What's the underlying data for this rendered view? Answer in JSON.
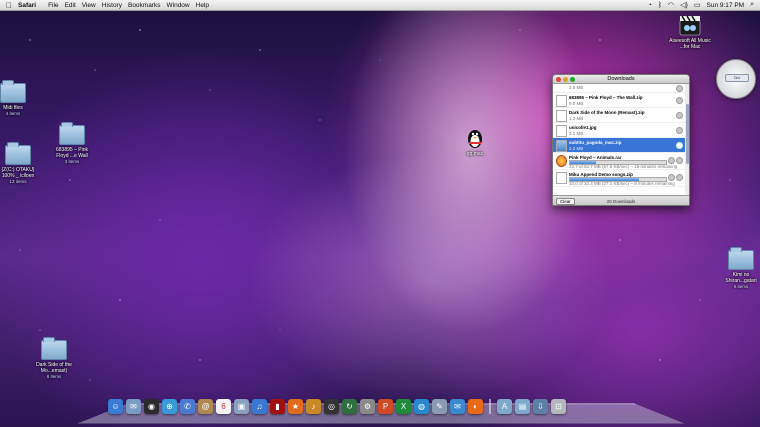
{
  "menubar": {
    "apple": "",
    "app_name": "Safari",
    "menus": [
      "File",
      "Edit",
      "View",
      "History",
      "Bookmarks",
      "Window",
      "Help"
    ],
    "clock": "Sun 9:17 PM"
  },
  "desktop": {
    "left_icons": [
      {
        "label": "Midi files",
        "sub": "4 items"
      },
      {
        "label": "683895 – Pink Floyd ...e Wall",
        "sub": "3 items"
      },
      {
        "label": "{Z(C:) OTAKU} 100% _ iclloen",
        "sub": "13 items"
      },
      {
        "label": "Dark Side of the Mo...emast)",
        "sub": "8 items"
      }
    ],
    "middle_icon": {
      "label": "qq.mac"
    },
    "right_icons": [
      {
        "label": "Aiseesoft All Music ...for Mac"
      },
      {
        "label": "Kimi no Shiran...gatari",
        "sub": "6 items"
      }
    ]
  },
  "downloads": {
    "title": "Downloads",
    "rows": [
      {
        "name": "",
        "size": "2.6 MB",
        "icon": "doc"
      },
      {
        "name": "683895 – Pink Floyd – The Wall.zip",
        "size": "9.0 MB",
        "icon": "doc"
      },
      {
        "name": "Dark Side of the Moon (Remast).zip",
        "size": "1.3 MB",
        "icon": "doc"
      },
      {
        "name": "unicolle1.jpg",
        "size": "3.1 MB",
        "icon": "doc"
      },
      {
        "name": "subtitu_pagoda_mac.zip",
        "size": "2.2 MB",
        "icon": "blue",
        "selected": true
      },
      {
        "name": "Pink Floyd – Animals.rar",
        "size": "22.7 of 82.7 MB (57.5 KB/sec) – 19 minutes remaining",
        "icon": "round",
        "progress": 0.27
      },
      {
        "name": "Miku Append Demo songs.zip",
        "size": "10.0 of 10.4 MB (27.1 KB/sec) – 8 minutes remaining",
        "icon": "doc",
        "progress": 0.72
      }
    ],
    "clear_label": "Clear",
    "count_label": "20 Downloads"
  },
  "widget": {
    "screen_text": "Dict"
  },
  "dock": {
    "icons": [
      {
        "name": "finder-icon",
        "color": "#3a7bd5",
        "glyph": "☺"
      },
      {
        "name": "preview-icon",
        "color": "#7a9bc4",
        "glyph": "✉"
      },
      {
        "name": "dashboard-icon",
        "color": "#2a2a2a",
        "glyph": "◉"
      },
      {
        "name": "safari-icon",
        "color": "#3a9ad9",
        "glyph": "⊕"
      },
      {
        "name": "ichat-icon",
        "color": "#4a7bd0",
        "glyph": "✆"
      },
      {
        "name": "address-book-icon",
        "color": "#b08950",
        "glyph": "@"
      },
      {
        "name": "ical-icon",
        "color": "#f4f4f4",
        "glyph": "6"
      },
      {
        "name": "iphoto-icon",
        "color": "#8aa0c0",
        "glyph": "▣"
      },
      {
        "name": "itunes-icon",
        "color": "#3b78d1",
        "glyph": "♫"
      },
      {
        "name": "photo-booth-icon",
        "color": "#a01010",
        "glyph": "▮"
      },
      {
        "name": "imovie-icon",
        "color": "#e06a1e",
        "glyph": "★"
      },
      {
        "name": "garageband-icon",
        "color": "#c8882a",
        "glyph": "♪"
      },
      {
        "name": "aperture-icon",
        "color": "#333333",
        "glyph": "◎"
      },
      {
        "name": "time-machine-icon",
        "color": "#2f6e3f",
        "glyph": "↻"
      },
      {
        "name": "system-preferences-icon",
        "color": "#8a8a8a",
        "glyph": "⚙"
      },
      {
        "name": "texture-app-icon",
        "color": "#d04a24",
        "glyph": "P"
      },
      {
        "name": "excel-icon",
        "color": "#1f8a3a",
        "glyph": "X"
      },
      {
        "name": "globe-icon",
        "color": "#2a88cc",
        "glyph": "◍"
      },
      {
        "name": "tool-icon",
        "color": "#8a9ab0",
        "glyph": "✎"
      },
      {
        "name": "mail-icon",
        "color": "#3a8ad0",
        "glyph": "✉"
      },
      {
        "name": "firefox-icon",
        "color": "#e86a18",
        "glyph": "◐"
      },
      {
        "name": "applications-folder-icon",
        "color": "#7fa9cc",
        "glyph": "A"
      },
      {
        "name": "documents-folder-icon",
        "color": "#7fa9cc",
        "glyph": "▤"
      },
      {
        "name": "downloads-stack-icon",
        "color": "#5c7fa6",
        "glyph": "⇩"
      },
      {
        "name": "trash-icon",
        "color": "#b4b8be",
        "glyph": "⊡"
      }
    ]
  }
}
